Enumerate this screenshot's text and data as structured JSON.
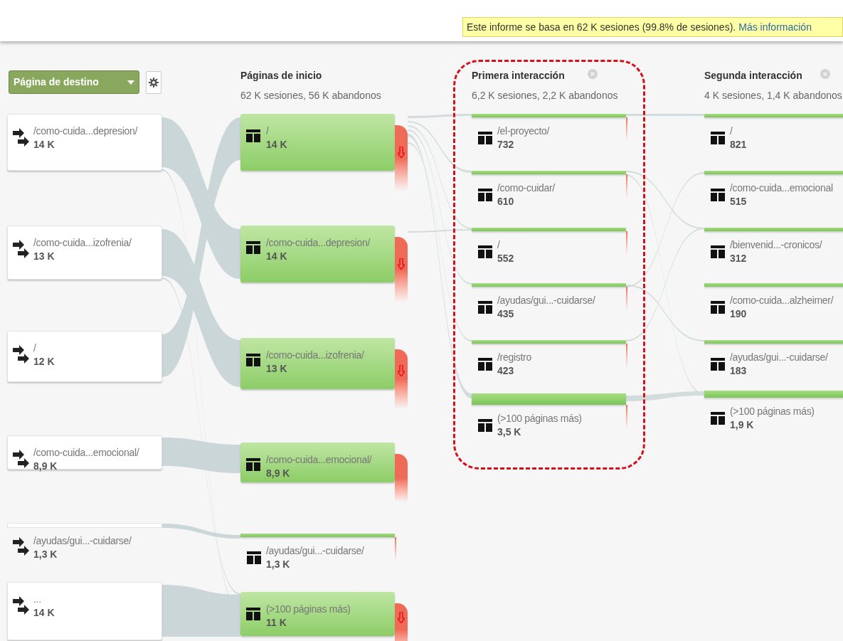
{
  "notice": {
    "text": "Este informe se basa en 62 K sesiones (99.8% de sesiones).",
    "link": "Más información"
  },
  "dimension_selector": {
    "label": "Página de destino"
  },
  "landing_pages": [
    {
      "kind": "block",
      "label": "/como-cuida...depresion/",
      "value": "14 K"
    },
    {
      "kind": "block",
      "label": "/como-cuida...izofrenia/",
      "value": "13 K"
    },
    {
      "kind": "block",
      "label": "/",
      "value": "12 K"
    },
    {
      "kind": "block",
      "label": "/como-cuida...emocional/",
      "value": "8,9 K"
    },
    {
      "kind": "bar",
      "label": "/ayudas/gui...-cuidarse/",
      "value": "1,3 K"
    },
    {
      "kind": "block",
      "label": "...",
      "value": "14 K"
    }
  ],
  "steps": [
    {
      "title": "Páginas de inicio",
      "summary": "62 K sesiones, 56 K abandonos",
      "removable": false,
      "highlighted": false,
      "nodes": [
        {
          "kind": "block",
          "label": "/",
          "value": "14 K",
          "exit_arrow": true
        },
        {
          "kind": "block",
          "label": "/como-cuida...depresion/",
          "value": "14 K",
          "exit_arrow": true
        },
        {
          "kind": "block",
          "label": "/como-cuida...izofrenia/",
          "value": "13 K",
          "exit_arrow": true
        },
        {
          "kind": "block",
          "label": "/como-cuida...emocional/",
          "value": "8,9 K",
          "exit_arrow": false
        },
        {
          "kind": "bar",
          "label": "/ayudas/gui...-cuidarse/",
          "value": "1,3 K",
          "exit_arrow": false
        },
        {
          "kind": "block",
          "label": "(>100 páginas más)",
          "value": "11 K",
          "exit_arrow": true
        }
      ]
    },
    {
      "title": "Primera interacción",
      "summary": "6,2 K sesiones, 2,2 K abandonos",
      "removable": true,
      "highlighted": true,
      "nodes": [
        {
          "kind": "bar",
          "label": "/el-proyecto/",
          "value": "732"
        },
        {
          "kind": "bar",
          "label": "/como-cuidar/",
          "value": "610"
        },
        {
          "kind": "bar",
          "label": "/",
          "value": "552"
        },
        {
          "kind": "bar",
          "label": "/ayudas/gui...-cuidarse/",
          "value": "435"
        },
        {
          "kind": "bar",
          "label": "/registro",
          "value": "423"
        },
        {
          "kind": "bar",
          "label": "(>100 páginas más)",
          "value": "3,5 K"
        }
      ]
    },
    {
      "title": "Segunda interacción",
      "summary": "4 K sesiones, 1,4 K abandonos",
      "removable": true,
      "highlighted": false,
      "nodes": [
        {
          "kind": "bar",
          "label": "/",
          "value": "821"
        },
        {
          "kind": "bar",
          "label": "/como-cuida...emocional",
          "value": "515"
        },
        {
          "kind": "bar",
          "label": "/bienvenid...-cronicos/",
          "value": "312"
        },
        {
          "kind": "bar",
          "label": "/como-cuida...alzheimer/",
          "value": "190"
        },
        {
          "kind": "bar",
          "label": "/ayudas/gui...-cuidarse/",
          "value": "183"
        },
        {
          "kind": "bar",
          "label": "(>100 páginas más)",
          "value": "1,9 K"
        }
      ]
    }
  ]
}
